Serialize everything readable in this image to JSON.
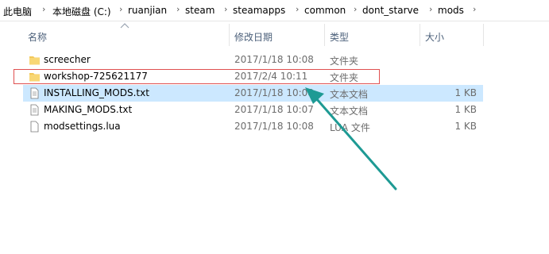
{
  "breadcrumb": [
    "此电脑",
    "本地磁盘 (C:)",
    "ruanjian",
    "steam",
    "steamapps",
    "common",
    "dont_starve",
    "mods"
  ],
  "columns": {
    "name": "名称",
    "date": "修改日期",
    "type": "类型",
    "size": "大小"
  },
  "files": [
    {
      "name": "screecher",
      "date": "2017/1/18 10:08",
      "type": "文件夹",
      "size": "",
      "icon": "folder-icon"
    },
    {
      "name": "workshop-725621177",
      "date": "2017/2/4 10:11",
      "type": "文件夹",
      "size": "",
      "icon": "folder-icon"
    },
    {
      "name": "INSTALLING_MODS.txt",
      "date": "2017/1/18 10:08",
      "type": "文本文档",
      "size": "1 KB",
      "icon": "text-file-icon"
    },
    {
      "name": "MAKING_MODS.txt",
      "date": "2017/1/18 10:07",
      "type": "文本文档",
      "size": "1 KB",
      "icon": "text-file-icon"
    },
    {
      "name": "modsettings.lua",
      "date": "2017/1/18 10:08",
      "type": "LUA 文件",
      "size": "1 KB",
      "icon": "lua-file-icon"
    }
  ],
  "colors": {
    "selection": "#cce8ff",
    "highlight_box": "#e05050",
    "annotation_arrow": "#1e9a94"
  }
}
